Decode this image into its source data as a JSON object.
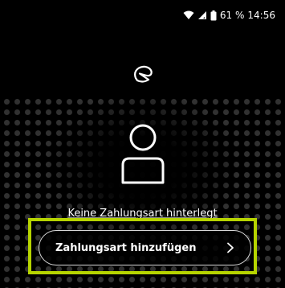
{
  "status_bar": {
    "battery_percent": "61 %",
    "time": "14:56",
    "wifi_icon": "wifi-icon",
    "signal_icon": "cell-signal-icon",
    "battery_icon": "battery-icon"
  },
  "header": {
    "logo_icon": "app-logo-icon"
  },
  "empty_state": {
    "icon": "user-icon",
    "message": "Keine Zahlungsart hinterlegt"
  },
  "actions": {
    "add_payment_label": "Zahlungsart hinzufügen",
    "chevron_icon": "chevron-right-icon"
  },
  "colors": {
    "background": "#000000",
    "highlight": "#b6d400",
    "text": "#ffffff"
  }
}
